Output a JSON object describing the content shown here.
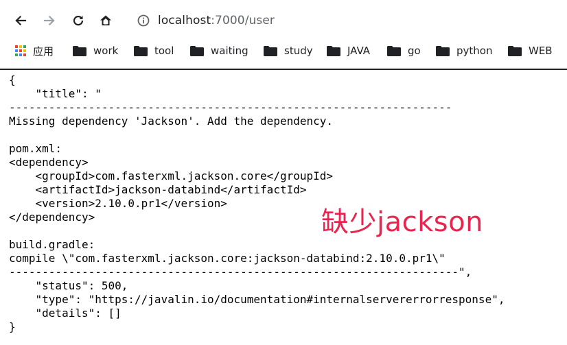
{
  "browser": {
    "url_host": "localhost",
    "url_rest": ":7000/user",
    "icons": {
      "back": "arrow-left-icon",
      "forward": "arrow-right-icon",
      "reload": "reload-icon",
      "home": "home-icon",
      "info": "info-icon"
    }
  },
  "bookmarks": [
    {
      "label": "应用",
      "icon": "apps-grid-icon"
    },
    {
      "label": "work",
      "icon": "folder-icon"
    },
    {
      "label": "tool",
      "icon": "folder-icon"
    },
    {
      "label": "waiting",
      "icon": "folder-icon"
    },
    {
      "label": "study",
      "icon": "folder-icon"
    },
    {
      "label": "JAVA",
      "icon": "folder-icon"
    },
    {
      "label": "go",
      "icon": "folder-icon"
    },
    {
      "label": "python",
      "icon": "folder-icon"
    },
    {
      "label": "WEB",
      "icon": "folder-icon"
    }
  ],
  "response_text": "{\n    \"title\": \"\n-------------------------------------------------------------------\nMissing dependency 'Jackson'. Add the dependency.\n\npom.xml:\n<dependency>\n    <groupId>com.fasterxml.jackson.core</groupId>\n    <artifactId>jackson-databind</artifactId>\n    <version>2.10.0.pr1</version>\n</dependency>\n\nbuild.gradle:\ncompile \\\"com.fasterxml.jackson.core:jackson-databind:2.10.0.pr1\\\"\n--------------------------------------------------------------------\",\n    \"status\": 500,\n    \"type\": \"https://javalin.io/documentation#internalservererrorresponse\",\n    \"details\": []\n}",
  "annotation": "缺少jackson",
  "colors": {
    "annotation": "#e8254e",
    "apps_grid": [
      "#ea4335",
      "#fbbc05",
      "#34a853",
      "#4285f4",
      "#ea4335",
      "#fbbc05",
      "#34a853",
      "#4285f4",
      "#ea4335"
    ]
  }
}
